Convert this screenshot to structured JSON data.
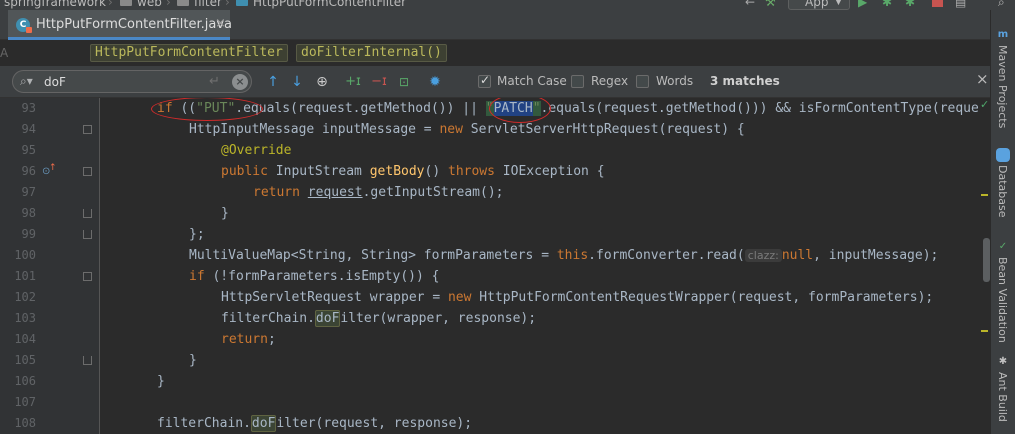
{
  "nav": {
    "crumbs": [
      "springframework",
      "web",
      "filter",
      "HttpPutFormContentFilter"
    ],
    "run_config": "App"
  },
  "tab": {
    "label": "HttpPutFormContentFilter.java",
    "close": "×"
  },
  "breadcrumb": {
    "class": "HttpPutFormContentFilter",
    "method": "doFilterInternal()"
  },
  "search": {
    "query": "doF",
    "enter_glyph": "↵",
    "clear_glyph": "×",
    "match_case_label": "Match Case",
    "match_case_checked": true,
    "regex_label": "Regex",
    "regex_checked": false,
    "words_label": "Words",
    "words_checked": false,
    "matches": "3 matches",
    "close": "×"
  },
  "editor": {
    "lines": [
      93,
      94,
      95,
      96,
      97,
      98,
      99,
      100,
      101,
      102,
      103,
      104,
      105,
      106,
      107,
      108
    ]
  },
  "code": {
    "l93": {
      "kw_if": "if",
      "p1": " ((",
      "put": "\"PUT\"",
      "p2": ".equals(request.getMethod()) || ",
      "patch_q1": "\"",
      "patch": "PATCH",
      "patch_q2": "\"",
      "p3": ".equals(request.getMethod())) && isFormContentType(reque"
    },
    "l94": {
      "p1": "HttpInputMessage inputMessage = ",
      "kw_new": "new",
      "p2": " ServletServerHttpRequest(request) {"
    },
    "l95": {
      "ann": "@Override"
    },
    "l96": {
      "kw_public": "public",
      "p1": " InputStream ",
      "fn": "getBody",
      "p2": "() ",
      "kw_throws": "throws",
      "p3": " IOException {"
    },
    "l97": {
      "kw_return": "return",
      "p1": " ",
      "u": "request",
      "p2": ".getInputStream();"
    },
    "l98": {
      "p1": "}"
    },
    "l99": {
      "p1": "};"
    },
    "l100": {
      "p1": "MultiValueMap<String, String> formParameters = ",
      "kw_this": "this",
      "p2": ".formConverter.read(",
      "hint": "clazz:",
      "kw_null": "null",
      "p3": ", inputMessage);"
    },
    "l101": {
      "kw_if": "if",
      "p1": " (!formParameters.isEmpty()) {"
    },
    "l102": {
      "p1": "HttpServletRequest wrapper = ",
      "kw_new": "new",
      "p2": " HttpPutFormContentRequestWrapper(request, formParameters);"
    },
    "l103": {
      "p1": "filterChain.",
      "match": "doF",
      "p2": "ilter(wrapper, response);"
    },
    "l104": {
      "kw_return": "return",
      "p1": ";"
    },
    "l105": {
      "p1": "}"
    },
    "l106": {
      "p1": "}"
    },
    "l107": {
      "p1": ""
    },
    "l108": {
      "p1": "filterChain.",
      "match": "doF",
      "p2": "ilter(request, response);"
    }
  },
  "tool_windows": [
    "Maven Projects",
    "Database",
    "Bean Validation",
    "Ant Build"
  ],
  "colors": {
    "background": "#2b2b2b",
    "keyword": "#cc7832",
    "string": "#6a8759",
    "annotation": "#bbb529",
    "method": "#ffc66d",
    "annotation_ellipse": "#d02b2b",
    "selection": "#214283"
  }
}
